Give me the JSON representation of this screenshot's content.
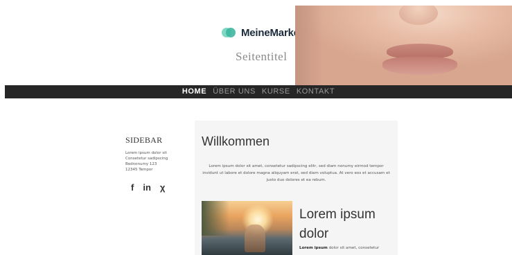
{
  "header": {
    "brand_name": "MeineMarke",
    "page_title": "Seitentitel",
    "hero_image": "lips-closeup-photo"
  },
  "nav": {
    "items": [
      {
        "label": "HOME",
        "active": true
      },
      {
        "label": "ÜBER UNS",
        "active": false
      },
      {
        "label": "KURSE",
        "active": false
      },
      {
        "label": "KONTAKT",
        "active": false
      }
    ]
  },
  "sidebar": {
    "title": "SIDEBAR",
    "lines": [
      "Lorem ipsum dolor sit",
      "Consetetur sadipscing",
      "Bednonumy 123",
      "12345 Tempor"
    ],
    "social": [
      {
        "icon": "facebook-icon",
        "glyph": "f"
      },
      {
        "icon": "linkedin-icon",
        "glyph": "in"
      },
      {
        "icon": "xing-icon",
        "glyph": "χ"
      }
    ]
  },
  "main": {
    "title": "Willkommen",
    "intro": "Lorem ipsum dolor sit amet, consetetur sadipscing elitr, sed diam nonumy eirmod tempor invidunt ut labore et dolore magna aliquyam erat, sed diam voluptua. At vero eos et accusam et justo duo dolores et ea rebum.",
    "feature": {
      "image": "sunset-woman-photo",
      "title": "Lorem ipsum dolor",
      "text_bold": "Lorem ipsum",
      "text": " dolor sit amet, consetetur"
    }
  },
  "colors": {
    "nav_bg": "#262626",
    "brand_accent": "#3fb7a0",
    "card_bg": "#f5f5f5"
  }
}
